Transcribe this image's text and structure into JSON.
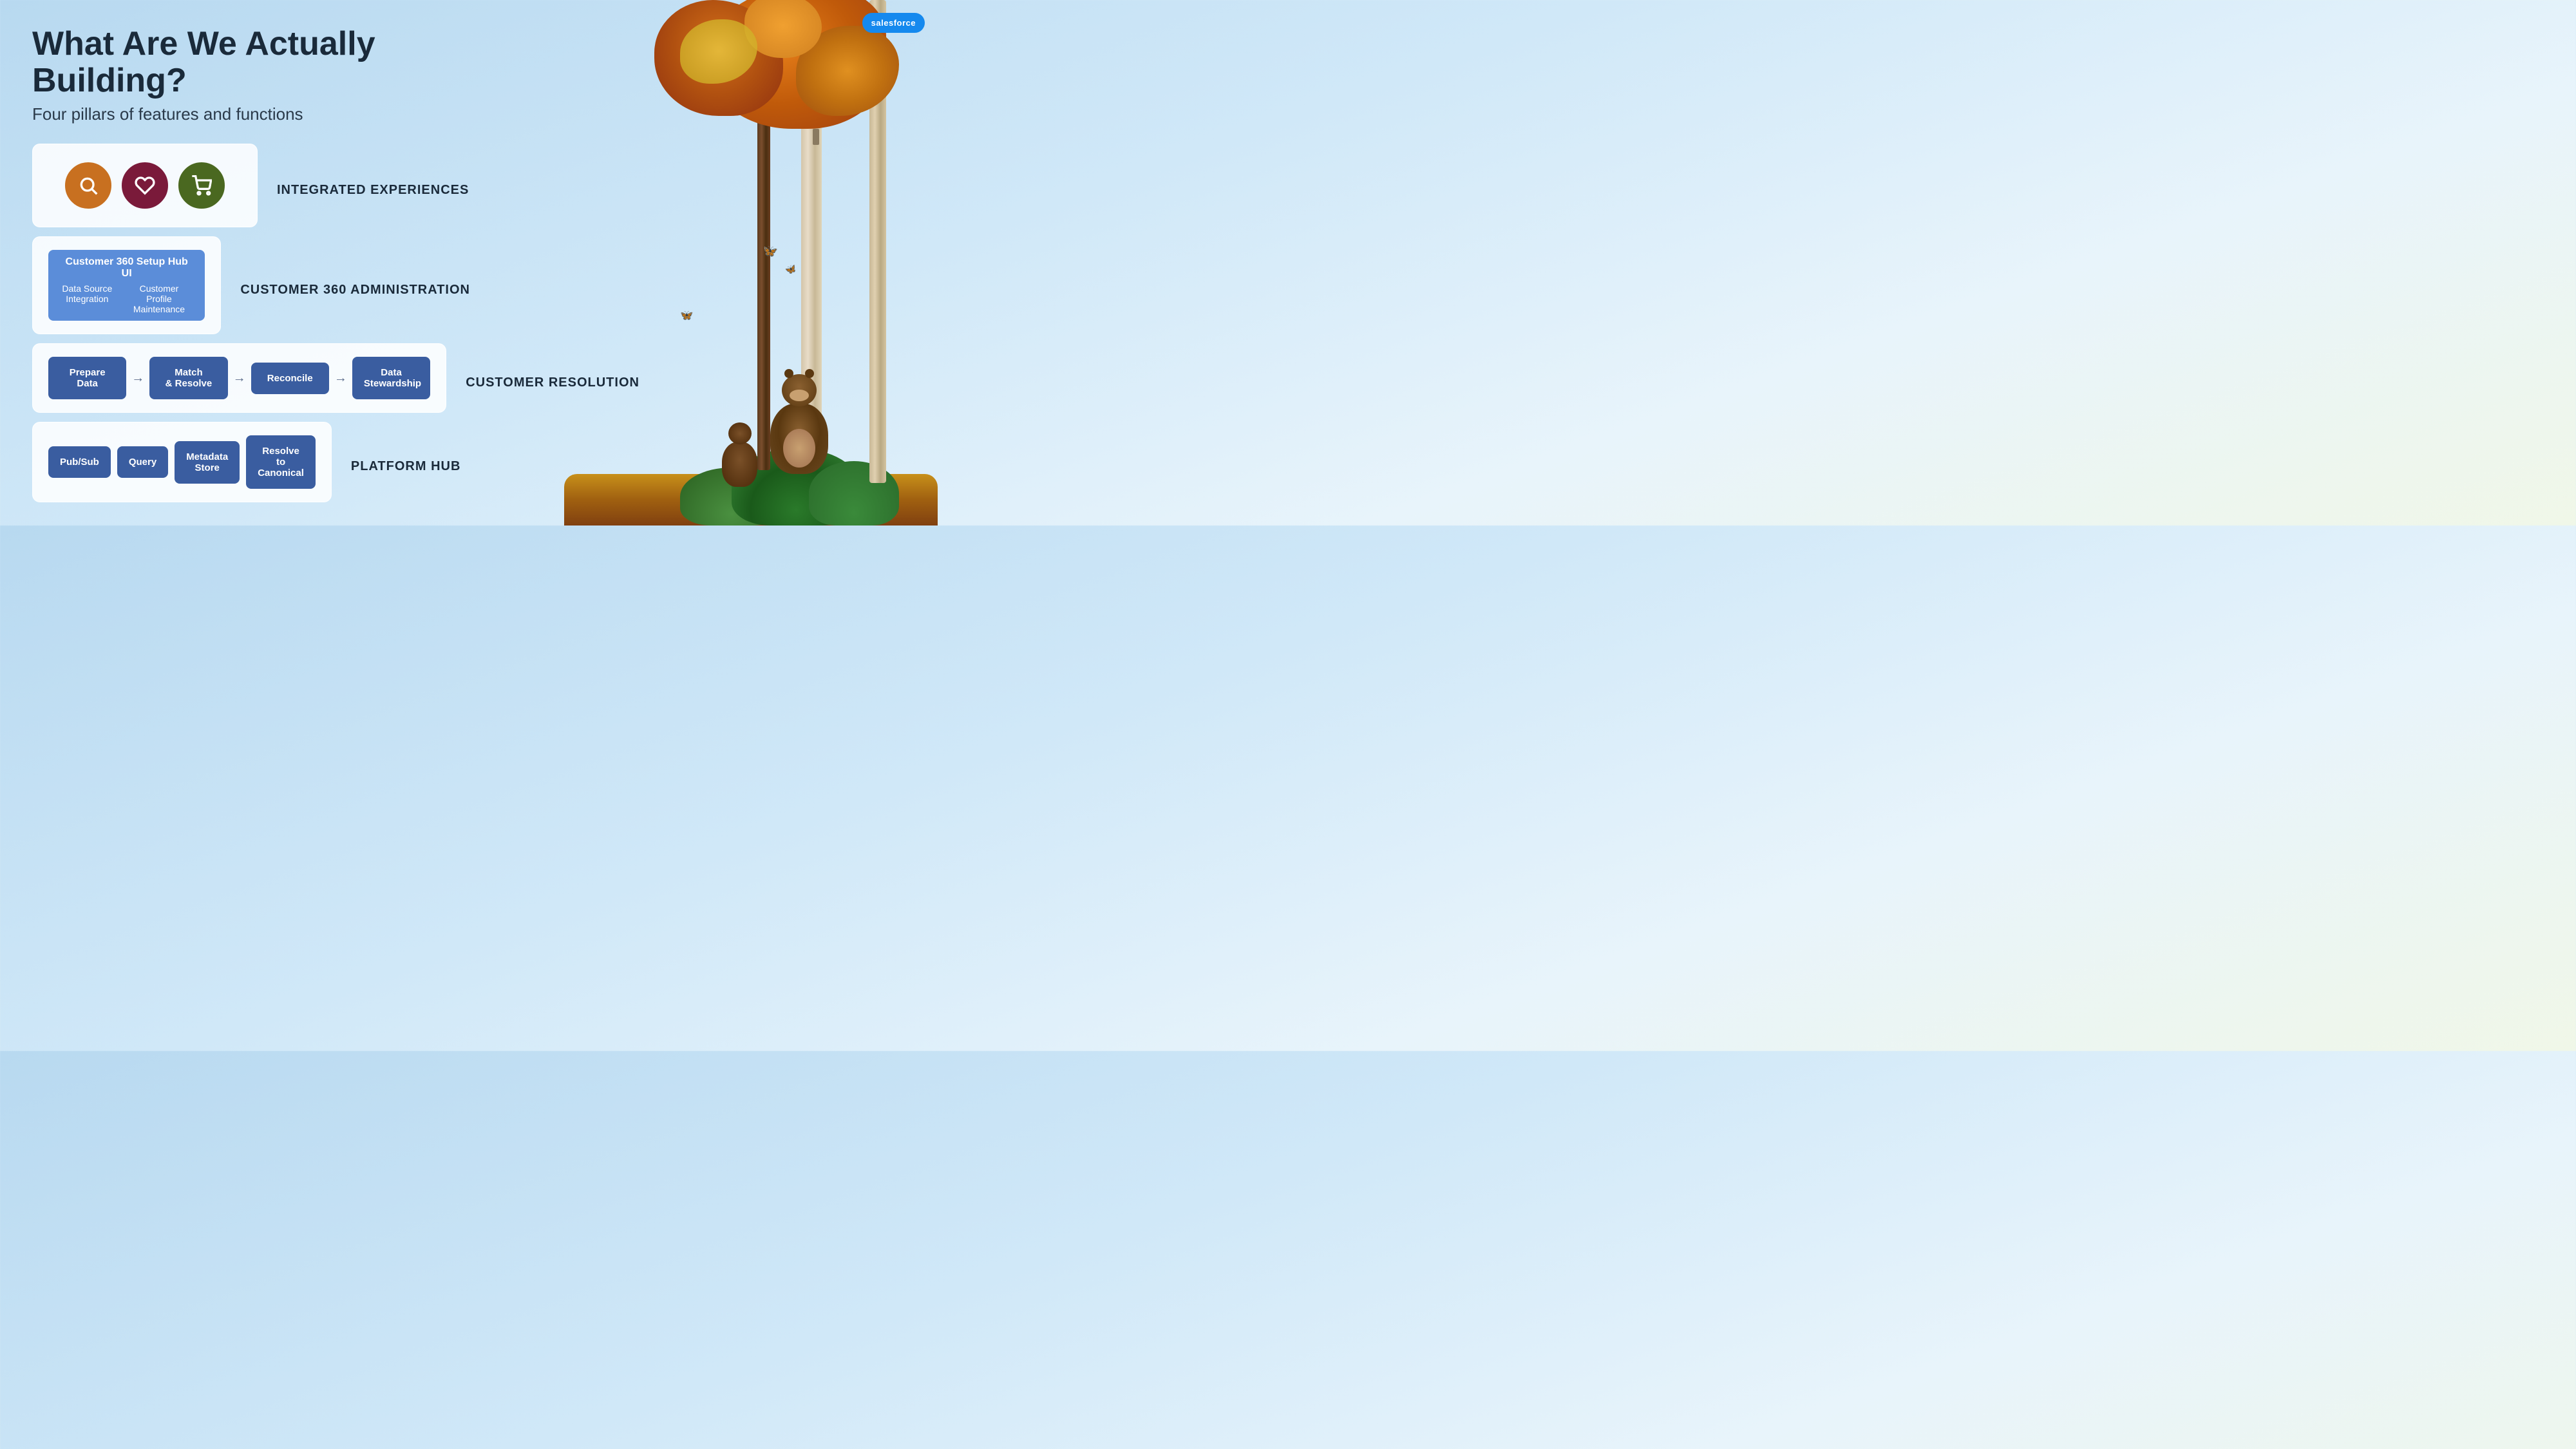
{
  "page": {
    "title": "What Are We Actually Building?",
    "subtitle": "Four pillars of features and functions",
    "sf_logo": "salesforce"
  },
  "pillars": [
    {
      "id": "integrated",
      "label": "INTEGRATED EXPERIENCES",
      "type": "icons",
      "icons": [
        {
          "name": "search",
          "symbol": "🔍",
          "color": "#c87020",
          "border": "#c87020"
        },
        {
          "name": "heart",
          "symbol": "♡",
          "color": "#7a1a3a",
          "border": "#7a1a3a"
        },
        {
          "name": "cart",
          "symbol": "🛒",
          "color": "#4a6820",
          "border": "#4a6820"
        }
      ]
    },
    {
      "id": "c360admin",
      "label": "CUSTOMER 360 ADMINISTRATION",
      "type": "c360",
      "top_label": "Customer 360 Setup Hub UI",
      "left_label": "Data Source Integration",
      "right_label": "Customer Profile Maintenance"
    },
    {
      "id": "resolution",
      "label": "CUSTOMER RESOLUTION",
      "type": "resolution",
      "steps": [
        {
          "label": "Prepare Data"
        },
        {
          "label": "Match\n& Resolve"
        },
        {
          "label": "Reconcile"
        },
        {
          "label": "Data\nStewardship"
        }
      ]
    },
    {
      "id": "platform",
      "label": "PLATFORM HUB",
      "type": "platform",
      "items": [
        {
          "label": "Pub/Sub"
        },
        {
          "label": "Query"
        },
        {
          "label": "Metadata\nStore"
        },
        {
          "label": "Resolve to\nCanonical"
        }
      ]
    }
  ],
  "butterflies": [
    "🦋",
    "🦋",
    "🦋"
  ]
}
